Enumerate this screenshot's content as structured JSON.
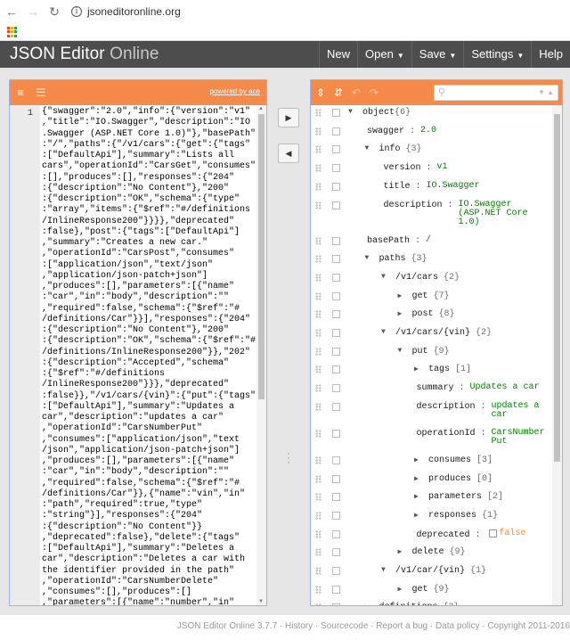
{
  "browser": {
    "url": "jsoneditoronline.org",
    "back_icon": "arrow-left-icon",
    "forward_icon": "arrow-right-icon",
    "reload_icon": "reload-icon"
  },
  "header": {
    "title_bold": "JSON Editor",
    "title_thin": " Online",
    "menu": [
      {
        "label": "New"
      },
      {
        "label": "Open"
      },
      {
        "label": "Save"
      },
      {
        "label": "Settings"
      },
      {
        "label": "Help"
      }
    ]
  },
  "left": {
    "powered_by": "powered by ace",
    "line_number": "1",
    "code": "{\"swagger\":\"2.0\",\"info\":{\"version\":\"v1\"\n,\"title\":\"IO.Swagger\",\"description\":\"IO\n.Swagger (ASP.NET Core 1.0)\"},\"basePath\"\n:\"/\",\"paths\":{\"/v1/cars\":{\"get\":{\"tags\"\n:[\"DefaultApi\"],\"summary\":\"Lists all\ncars\",\"operationId\":\"CarsGet\",\"consumes\"\n:[],\"produces\":[],\"responses\":{\"204\"\n:{\"description\":\"No Content\"},\"200\"\n:{\"description\":\"OK\",\"schema\":{\"type\"\n:\"array\",\"items\":{\"$ref\":\"#/definitions\n/InlineResponse200\"}}}},\"deprecated\"\n:false},\"post\":{\"tags\":[\"DefaultApi\"]\n,\"summary\":\"Creates a new car.\"\n,\"operationId\":\"CarsPost\",\"consumes\"\n:[\"application/json\",\"text/json\"\n,\"application/json-patch+json\"]\n,\"produces\":[],\"parameters\":[{\"name\"\n:\"car\",\"in\":\"body\",\"description\":\"\"\n,\"required\":false,\"schema\":{\"$ref\":\"#\n/definitions/Car\"}}],\"responses\":{\"204\"\n:{\"description\":\"No Content\"},\"200\"\n:{\"description\":\"OK\",\"schema\":{\"$ref\":\"#\n/definitions/InlineResponse200\"}},\"202\"\n:{\"description\":\"Accepted\",\"schema\"\n:{\"$ref\":\"#/definitions\n/InlineResponse200\"}}},\"deprecated\"\n:false}},\"/v1/cars/{vin}\":{\"put\":{\"tags\"\n:[\"DefaultApi\"],\"summary\":\"Updates a\ncar\",\"description\":\"updates a car\"\n,\"operationId\":\"CarsNumberPut\"\n,\"consumes\":[\"application/json\",\"text\n/json\",\"application/json-patch+json\"]\n,\"produces\":[],\"parameters\":[{\"name\"\n:\"car\",\"in\":\"body\",\"description\":\"\"\n,\"required\":false,\"schema\":{\"$ref\":\"#\n/definitions/Car\"}},{\"name\":\"vin\",\"in\"\n:\"path\",\"required\":true,\"type\"\n:\"string\"}],\"responses\":{\"204\"\n:{\"description\":\"No Content\"}}\n,\"deprecated\":false},\"delete\":{\"tags\"\n:[\"DefaultApi\"],\"summary\":\"Deletes a\ncar\",\"description\":\"Deletes a car with\nthe identifier provided in the path\"\n,\"operationId\":\"CarsNumberDelete\"\n,\"consumes\":[],\"produces\":[]\n,\"parameters\":[{\"name\":\"number\",\"in\""
  },
  "tree": {
    "rows": [
      {
        "key": "object",
        "sep": "",
        "count": "{6}",
        "value": "",
        "kind": "",
        "indent": 0,
        "toggle": "down"
      },
      {
        "key": "swagger",
        "sep": " : ",
        "count": "",
        "value": "2.0",
        "kind": "str",
        "indent": 2,
        "toggle": ""
      },
      {
        "key": "info",
        "sep": " ",
        "count": "{3}",
        "value": "",
        "kind": "",
        "indent": 1,
        "toggle": "down"
      },
      {
        "key": "version",
        "sep": " : ",
        "count": "",
        "value": "v1",
        "kind": "str",
        "indent": 3,
        "toggle": ""
      },
      {
        "key": "title",
        "sep": " : ",
        "count": "",
        "value": "IO.Swagger",
        "kind": "str",
        "indent": 3,
        "toggle": ""
      },
      {
        "key": "description",
        "sep": " : ",
        "count": "",
        "value": "IO.Swagger\n(ASP.NET Core\n1.0)",
        "kind": "str",
        "indent": 3,
        "toggle": ""
      },
      {
        "key": "basePath",
        "sep": " : ",
        "count": "",
        "value": "/",
        "kind": "str",
        "indent": 2,
        "toggle": ""
      },
      {
        "key": "paths",
        "sep": " ",
        "count": "{3}",
        "value": "",
        "kind": "",
        "indent": 1,
        "toggle": "down"
      },
      {
        "key": "/v1/cars",
        "sep": " ",
        "count": "{2}",
        "value": "",
        "kind": "",
        "indent": 2,
        "toggle": "down"
      },
      {
        "key": "get",
        "sep": " ",
        "count": "{7}",
        "value": "",
        "kind": "",
        "indent": 3,
        "toggle": "right"
      },
      {
        "key": "post",
        "sep": " ",
        "count": "{8}",
        "value": "",
        "kind": "",
        "indent": 3,
        "toggle": "right"
      },
      {
        "key": "/v1/cars/{vin}",
        "sep": " ",
        "count": "{2}",
        "value": "",
        "kind": "",
        "indent": 2,
        "toggle": "down"
      },
      {
        "key": "put",
        "sep": " ",
        "count": "{9}",
        "value": "",
        "kind": "",
        "indent": 3,
        "toggle": "down"
      },
      {
        "key": "tags",
        "sep": " ",
        "count": "[1]",
        "value": "",
        "kind": "",
        "indent": 4,
        "toggle": "right"
      },
      {
        "key": "summary",
        "sep": " : ",
        "count": "",
        "value": "Updates a car",
        "kind": "str",
        "indent": 5,
        "toggle": ""
      },
      {
        "key": "description",
        "sep": " : ",
        "count": "",
        "value": "updates a\ncar",
        "kind": "str",
        "indent": 5,
        "toggle": ""
      },
      {
        "key": "operationId",
        "sep": " : ",
        "count": "",
        "value": "CarsNumber\nPut",
        "kind": "str",
        "indent": 5,
        "toggle": ""
      },
      {
        "key": "consumes",
        "sep": " ",
        "count": "[3]",
        "value": "",
        "kind": "",
        "indent": 4,
        "toggle": "right"
      },
      {
        "key": "produces",
        "sep": " ",
        "count": "[0]",
        "value": "",
        "kind": "",
        "indent": 4,
        "toggle": "right"
      },
      {
        "key": "parameters",
        "sep": " ",
        "count": "[2]",
        "value": "",
        "kind": "",
        "indent": 4,
        "toggle": "right"
      },
      {
        "key": "responses",
        "sep": " ",
        "count": "{1}",
        "value": "",
        "kind": "",
        "indent": 4,
        "toggle": "right"
      },
      {
        "key": "deprecated",
        "sep": " : ",
        "count": "",
        "value": "false",
        "kind": "bool",
        "indent": 5,
        "toggle": ""
      },
      {
        "key": "delete",
        "sep": " ",
        "count": "{9}",
        "value": "",
        "kind": "",
        "indent": 3,
        "toggle": "right"
      },
      {
        "key": "/v1/car/{vin}",
        "sep": " ",
        "count": "{1}",
        "value": "",
        "kind": "",
        "indent": 2,
        "toggle": "down"
      },
      {
        "key": "get",
        "sep": " ",
        "count": "{9}",
        "value": "",
        "kind": "",
        "indent": 3,
        "toggle": "right"
      },
      {
        "key": "definitions",
        "sep": " ",
        "count": "{2}",
        "value": "",
        "kind": "",
        "indent": 1,
        "toggle": "right"
      }
    ]
  },
  "footer": {
    "text": "JSON Editor Online 3.7.7 · History · Sourcecode · Report a bug · Data policy · Copyright 2011-2016"
  },
  "colors": {
    "toolbar": "#f58a4b",
    "header": "#4d4d4d",
    "string_value": "#008000",
    "bool_value": "#ff8c00"
  }
}
